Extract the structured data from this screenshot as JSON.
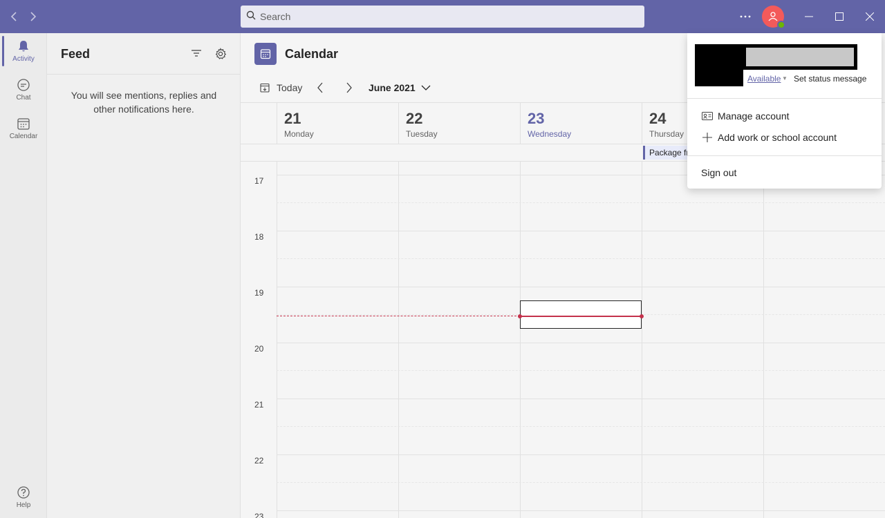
{
  "titlebar": {
    "search_placeholder": "Search",
    "accent": "#6264a7",
    "icons": [
      "back-arrow-icon",
      "forward-arrow-icon",
      "search-icon",
      "more-options-icon",
      "minimize-icon",
      "maximize-icon",
      "close-icon"
    ]
  },
  "rail": {
    "items": [
      {
        "label": "Activity",
        "icon": "bell-icon",
        "active": true
      },
      {
        "label": "Chat",
        "icon": "chat-icon"
      },
      {
        "label": "Calendar",
        "icon": "calendar-icon"
      }
    ],
    "help_label": "Help"
  },
  "feed": {
    "title": "Feed",
    "empty_message": "You will see mentions, replies and other notifications here."
  },
  "calendar": {
    "title": "Calendar",
    "today_label": "Today",
    "month_label": "June 2021",
    "days": [
      {
        "num": "21",
        "name": "Monday"
      },
      {
        "num": "22",
        "name": "Tuesday"
      },
      {
        "num": "23",
        "name": "Wednesday",
        "today": true
      },
      {
        "num": "24",
        "name": "Thursday"
      }
    ],
    "event_chip": "Package fr",
    "hours": [
      "17",
      "18",
      "19",
      "20",
      "21",
      "22",
      "23"
    ],
    "now_color": "#c4314b"
  },
  "profile_menu": {
    "status": "Available",
    "set_status": "Set status message",
    "manage_account": "Manage account",
    "add_account": "Add work or school account",
    "sign_out": "Sign out"
  }
}
